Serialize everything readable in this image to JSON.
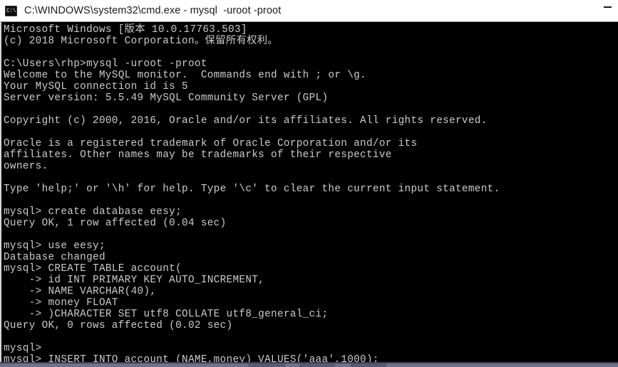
{
  "window": {
    "title": "C:\\WINDOWS\\system32\\cmd.exe - mysql  -uroot -proot",
    "icon": "cmd-console-icon",
    "minimize_label": "—",
    "background_color": "#000000",
    "titlebar_color": "#ffffff",
    "text_color": "#cccccc"
  },
  "terminal": {
    "lines": [
      "Microsoft Windows [版本 10.0.17763.503]",
      "(c) 2018 Microsoft Corporation。保留所有权利。",
      "",
      "C:\\Users\\rhp>mysql -uroot -proot",
      "Welcome to the MySQL monitor.  Commands end with ; or \\g.",
      "Your MySQL connection id is 5",
      "Server version: 5.5.49 MySQL Community Server (GPL)",
      "",
      "Copyright (c) 2000, 2016, Oracle and/or its affiliates. All rights reserved.",
      "",
      "Oracle is a registered trademark of Oracle Corporation and/or its",
      "affiliates. Other names may be trademarks of their respective",
      "owners.",
      "",
      "Type 'help;' or '\\h' for help. Type '\\c' to clear the current input statement.",
      "",
      "mysql> create database eesy;",
      "Query OK, 1 row affected (0.04 sec)",
      "",
      "mysql> use eesy;",
      "Database changed",
      "mysql> CREATE TABLE account(",
      "    -> id INT PRIMARY KEY AUTO_INCREMENT,",
      "    -> NAME VARCHAR(40),",
      "    -> money FLOAT",
      "    -> )CHARACTER SET utf8 COLLATE utf8_general_ci;",
      "Query OK, 0 rows affected (0.02 sec)",
      "",
      "mysql>",
      "mysql> INSERT INTO account (NAME,money) VALUES('aaa',1000);"
    ]
  },
  "taskbar": {
    "visible": true,
    "color": "#6d7189"
  }
}
